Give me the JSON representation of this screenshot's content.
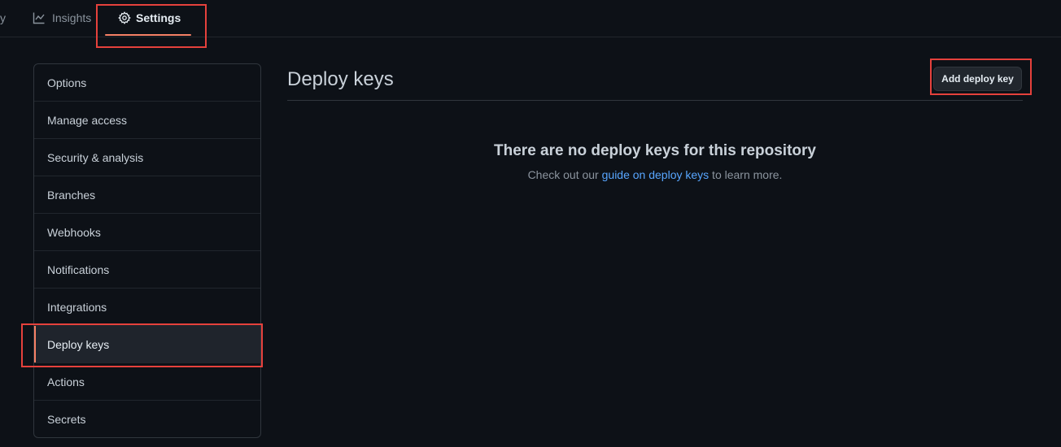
{
  "nav": {
    "partial_label": "y",
    "insights_label": "Insights",
    "settings_label": "Settings"
  },
  "sidebar": {
    "items": [
      {
        "label": "Options"
      },
      {
        "label": "Manage access"
      },
      {
        "label": "Security & analysis"
      },
      {
        "label": "Branches"
      },
      {
        "label": "Webhooks"
      },
      {
        "label": "Notifications"
      },
      {
        "label": "Integrations"
      },
      {
        "label": "Deploy keys",
        "selected": true
      },
      {
        "label": "Actions"
      },
      {
        "label": "Secrets"
      }
    ]
  },
  "main": {
    "title": "Deploy keys",
    "add_button_label": "Add deploy key",
    "blankslate": {
      "heading": "There are no deploy keys for this repository",
      "desc_before": "Check out our ",
      "link_text": "guide on deploy keys",
      "desc_after": " to learn more."
    }
  },
  "colors": {
    "background": "#0d1117",
    "accent_underline": "#f78166",
    "link": "#58a6ff",
    "highlight_box": "#e5413c"
  },
  "icons": {
    "insights": "graph-icon",
    "settings": "gear-icon"
  }
}
